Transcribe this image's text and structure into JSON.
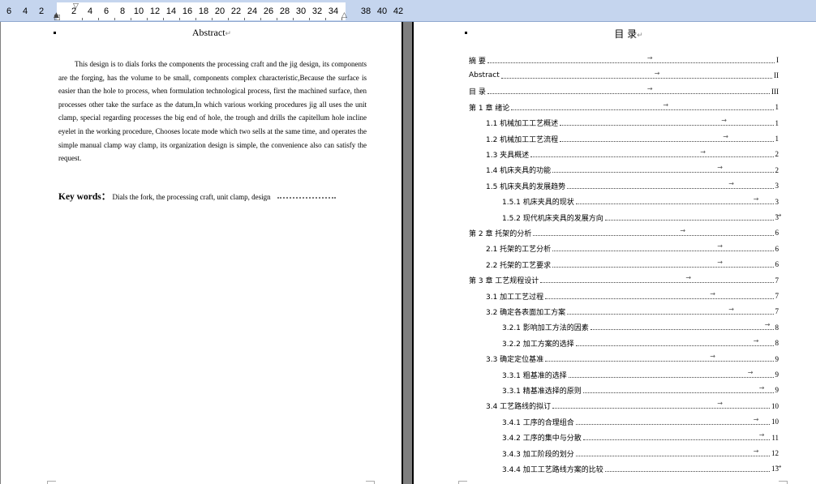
{
  "ruler": {
    "left_numbers": [
      "6",
      "4",
      "2"
    ],
    "numbers": [
      "2",
      "4",
      "6",
      "8",
      "10",
      "12",
      "14",
      "16",
      "18",
      "20",
      "22",
      "24",
      "26",
      "28",
      "30",
      "32",
      "34"
    ],
    "right_numbers": [
      "38",
      "40",
      "42"
    ]
  },
  "left_page": {
    "title": "Abstract",
    "para_mark": "↵",
    "body": "This design is to dials forks the components the processing craft and the jig design, its components are the forging, has the volume to be small, components complex characteristic,Because the surface is easier than the hole to process, when formulation technological process, first the machined surface, then processes other take the surface as the datum,In which various working procedures jig all uses the unit clamp, special regarding processes the big end of hole, the trough and drills the capitellum hole incline eyelet in the working procedure, Chooses locate mode which two sells at the same time, and operates the simple manual clamp way clamp, its organization design is simple, the convenience also can satisfy the request.",
    "keywords_label": "Key words：",
    "keywords_text": "Dials the fork, the processing craft, unit clamp, design"
  },
  "right_page": {
    "title": "目  录",
    "toc": [
      {
        "label": "摘  要",
        "page": "I",
        "indent": 0
      },
      {
        "label": "Abstract",
        "page": "II",
        "indent": 0
      },
      {
        "label": "目  录",
        "page": "III",
        "indent": 0
      },
      {
        "label": "第 1 章  绪论",
        "page": "1",
        "indent": 0
      },
      {
        "label": "1.1  机械加工工艺概述",
        "page": "1",
        "indent": 1
      },
      {
        "label": "1.2 机械加工工艺流程",
        "page": "1",
        "indent": 1
      },
      {
        "label": "1.3 夹具概述",
        "page": "2",
        "indent": 1
      },
      {
        "label": "1.4 机床夹具的功能",
        "page": "2",
        "indent": 1
      },
      {
        "label": "1.5 机床夹具的发展趋势",
        "page": "3",
        "indent": 1
      },
      {
        "label": "1.5.1 机床夹具的现状",
        "page": "3",
        "indent": 2
      },
      {
        "label": "1.5.2 现代机床夹具的发展方向",
        "page": "3",
        "indent": 2
      },
      {
        "label": "第 2 章  托架的分析",
        "page": "6",
        "indent": 0
      },
      {
        "label": "2.1 托架的工艺分析",
        "page": "6",
        "indent": 1
      },
      {
        "label": "2.2 托架的工艺要求",
        "page": "6",
        "indent": 1
      },
      {
        "label": "第 3 章  工艺规程设计",
        "page": "7",
        "indent": 0
      },
      {
        "label": "3.1  加工工艺过程",
        "page": "7",
        "indent": 1
      },
      {
        "label": "3.2 确定各表面加工方案",
        "page": "7",
        "indent": 1
      },
      {
        "label": "3.2.1 影响加工方法的因素",
        "page": "8",
        "indent": 2
      },
      {
        "label": "3.2.2 加工方案的选择",
        "page": "8",
        "indent": 2
      },
      {
        "label": "3.3  确定定位基准",
        "page": "9",
        "indent": 1
      },
      {
        "label": "3.3.1 粗基准的选择",
        "page": "9",
        "indent": 2
      },
      {
        "label": "3.3.1 精基准选择的原则",
        "page": "9",
        "indent": 2
      },
      {
        "label": "3.4 工艺路线的拟订",
        "page": "10",
        "indent": 1
      },
      {
        "label": "3.4.1 工序的合理组合",
        "page": "10",
        "indent": 2
      },
      {
        "label": "3.4.2 工序的集中与分散",
        "page": "11",
        "indent": 2
      },
      {
        "label": "3.4.3 加工阶段的划分",
        "page": "12",
        "indent": 2
      },
      {
        "label": "3.4.4 加工工艺路线方案的比较",
        "page": "13",
        "indent": 2
      }
    ]
  }
}
